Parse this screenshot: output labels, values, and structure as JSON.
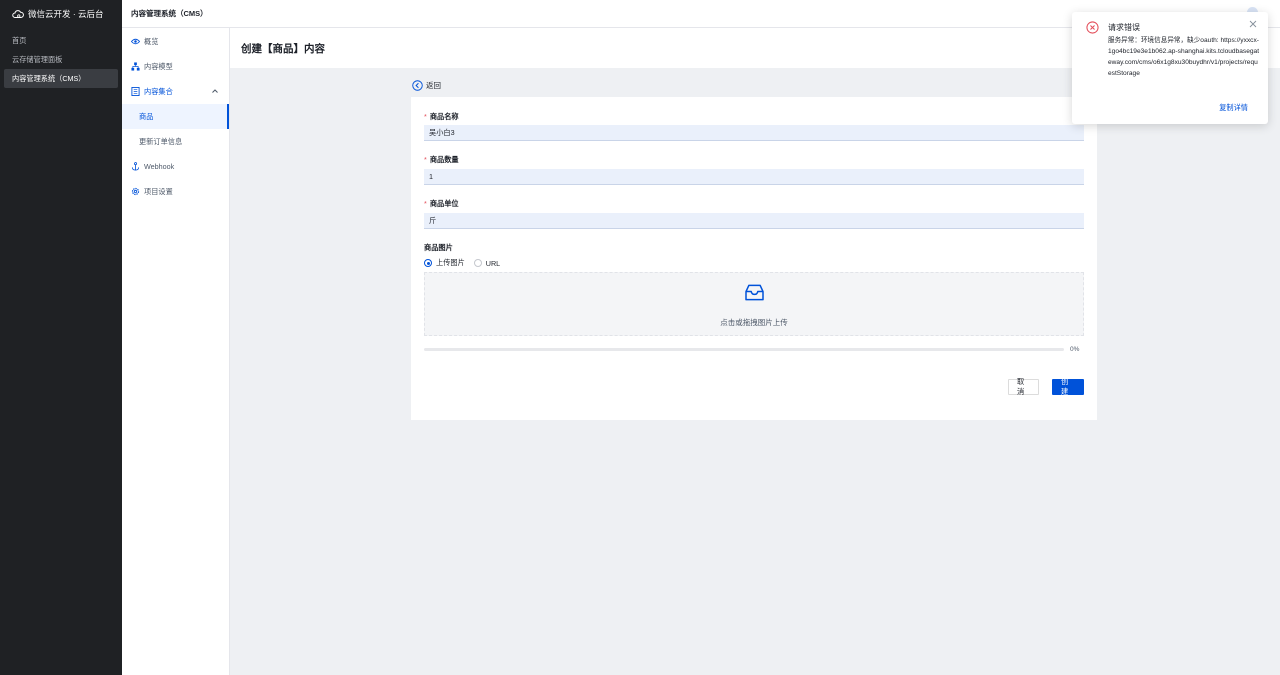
{
  "app": {
    "brand": "微信云开发 · 云后台"
  },
  "sidebar": {
    "items": [
      {
        "label": "首页"
      },
      {
        "label": "云存储管理面板"
      },
      {
        "label": "内容管理系统（CMS）"
      }
    ]
  },
  "topbar": {
    "title": "内容管理系统（CMS）"
  },
  "subnav": {
    "items": [
      {
        "label": "概览"
      },
      {
        "label": "内容模型"
      },
      {
        "label": "内容集合"
      },
      {
        "label": "商品"
      },
      {
        "label": "更新订单信息"
      },
      {
        "label": "Webhook"
      },
      {
        "label": "项目设置"
      }
    ]
  },
  "page": {
    "title": "创建【商品】内容",
    "back_label": "返回"
  },
  "form": {
    "fields": [
      {
        "label": "商品名称",
        "required": true,
        "value": "吴小白3"
      },
      {
        "label": "商品数量",
        "required": true,
        "value": "1"
      },
      {
        "label": "商品单位",
        "required": true,
        "value": "斤"
      }
    ],
    "image_label": "商品图片",
    "image_options": [
      "上传图片",
      "URL"
    ],
    "image_selected": "上传图片",
    "upload_text": "点击或拖拽图片上传",
    "progress_percent": 0,
    "progress_label": "0%",
    "cancel_label": "取消",
    "create_label": "创建"
  },
  "toast": {
    "title": "请求错误",
    "message": "服务异常：环境信息异常，缺少oauth: https://yxxcx-1go4bc19e3e1b062.ap-shanghai.kits.tcloudbasegateway.com/cms/o6x1g8xu30buydhr/v1/projects/requestStorage",
    "action_label": "复制详情"
  },
  "colors": {
    "primary": "#0052d9",
    "sidebar_bg": "#1f2124",
    "error": "#e34d59"
  }
}
